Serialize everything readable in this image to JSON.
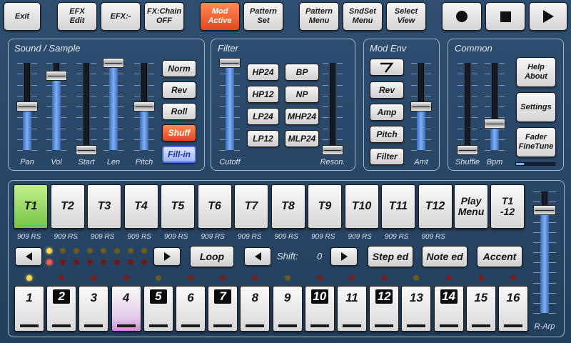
{
  "toolbar": {
    "exit": "Exit",
    "efx_edit": "EFX\nEdit",
    "efx": "EFX:-",
    "fx_chain": "FX:Chain\nOFF",
    "mod_active": "Mod\nActive",
    "pattern_set": "Pattern\nSet",
    "pattern_menu": "Pattern\nMenu",
    "sndset_menu": "SndSet\nMenu",
    "select_view": "Select\nView",
    "record_icon": "record-icon",
    "stop_icon": "stop-icon",
    "play_icon": "play-icon"
  },
  "sound_sample": {
    "title": "Sound / Sample",
    "faders": [
      {
        "label": "Pan",
        "value": 0.5
      },
      {
        "label": "Vol",
        "value": 0.85
      },
      {
        "label": "Start",
        "value": 0.0
      },
      {
        "label": "Len",
        "value": 1.0
      },
      {
        "label": "Pitch",
        "value": 0.5
      }
    ],
    "buttons": [
      "Norm",
      "Rev",
      "Roll",
      "Shuff",
      "Fill-in"
    ]
  },
  "filter": {
    "title": "Filter",
    "faders": [
      {
        "label": "Cutoff",
        "value": 1.0
      },
      {
        "label": "Reson.",
        "value": 0.0
      }
    ],
    "types": [
      "HP24",
      "BP",
      "HP12",
      "NP",
      "LP24",
      "MHP24",
      "LP12",
      "MLP24"
    ]
  },
  "mod_env": {
    "title": "Mod Env",
    "shape_icon": "envelope-shape-icon",
    "buttons": [
      "Rev",
      "Amp",
      "Pitch",
      "Filter"
    ],
    "fader": {
      "label": "Amt",
      "value": 0.5
    }
  },
  "common": {
    "title": "Common",
    "faders": [
      {
        "label": "Shuffle",
        "value": 0.0
      },
      {
        "label": "Bpm",
        "value": 0.3
      }
    ],
    "buttons": [
      "Help\nAbout",
      "Settings",
      "Fader\nFineTune"
    ],
    "finetune_level": 0.2
  },
  "tracks": {
    "items": [
      "T1",
      "T2",
      "T3",
      "T4",
      "T5",
      "T6",
      "T7",
      "T8",
      "T9",
      "T10",
      "T11",
      "T12"
    ],
    "selected": 0,
    "sound_labels": [
      "909 RS",
      "909 RS",
      "909 RS",
      "909 RS",
      "909 RS",
      "909 RS",
      "909 RS",
      "909 RS",
      "909 RS",
      "909 RS",
      "909 RS",
      "909 RS"
    ],
    "play_menu": "Play\nMenu",
    "t1_12": "T1\n-12",
    "r_arp_label": "R-Arp",
    "r_arp_value": 0.85
  },
  "sequencer": {
    "loop": "Loop",
    "shift_label": "Shift:",
    "shift_value": "0",
    "step_ed": "Step ed",
    "note_ed": "Note ed",
    "accent": "Accent",
    "left_icon": "left-arrow-icon",
    "right_icon": "right-arrow-icon",
    "steps": [
      "1",
      "2",
      "3",
      "4",
      "5",
      "6",
      "7",
      "8",
      "9",
      "10",
      "11",
      "12",
      "13",
      "14",
      "15",
      "16"
    ],
    "accented_steps": [
      1,
      4,
      6,
      9,
      11,
      13
    ],
    "current_step": 0,
    "pink_step": 3
  },
  "colors": {
    "accent_orange": "#e5471e",
    "selected_green": "#78c244",
    "fader_blue": "#7fb1ee",
    "background": "#2a4766"
  }
}
